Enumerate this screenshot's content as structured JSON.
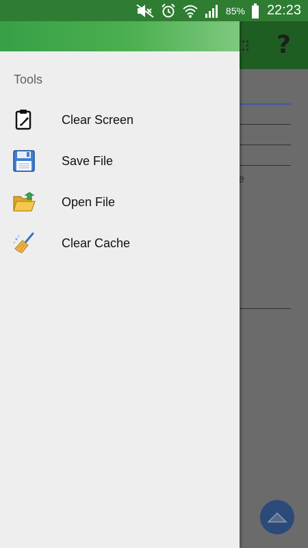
{
  "status_bar": {
    "battery": "85%",
    "time": "22:23",
    "icons": [
      "mute-icon",
      "alarm-icon",
      "wifi-icon",
      "signal-icon",
      "battery-icon"
    ]
  },
  "drawer": {
    "section_label": "Tools",
    "items": [
      {
        "label": "Clear Screen",
        "icon": "clipboard-icon"
      },
      {
        "label": "Save File",
        "icon": "floppy-disk-icon"
      },
      {
        "label": "Open File",
        "icon": "open-folder-icon"
      },
      {
        "label": "Clear Cache",
        "icon": "broom-icon"
      }
    ]
  },
  "background_app": {
    "partial_text": "e",
    "help_glyph": "?"
  },
  "colors": {
    "status_bar": "#2e7d32",
    "drawer_header_start": "#37a046",
    "drawer_header_end": "#7fc97f",
    "drawer_bg": "#eeeeee",
    "fab": "#2b4a78"
  }
}
